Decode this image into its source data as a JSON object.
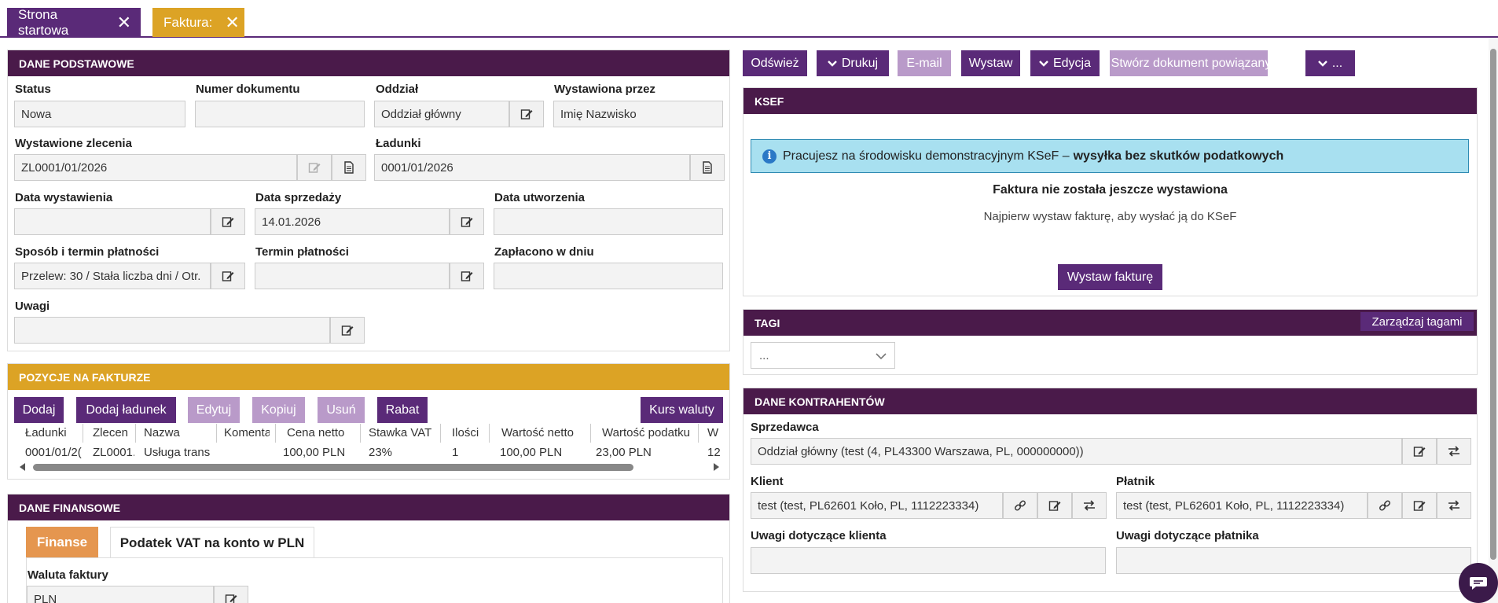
{
  "tabs": [
    {
      "label": "Strona startowa"
    },
    {
      "label": "Faktura:"
    }
  ],
  "basic": {
    "title": "DANE PODSTAWOWE",
    "status_label": "Status",
    "status_value": "Nowa",
    "docnum_label": "Numer dokumentu",
    "docnum_value": "",
    "branch_label": "Oddział",
    "branch_value": "Oddział główny",
    "issued_by_label": "Wystawiona przez",
    "issued_by_value": "Imię Nazwisko",
    "orders_label": "Wystawione zlecenia",
    "orders_value": "ZL0001/01/2026",
    "loads_label": "Ładunki",
    "loads_value": "0001/01/2026",
    "issue_date_label": "Data wystawienia",
    "issue_date_value": "",
    "sale_date_label": "Data sprzedaży",
    "sale_date_value": "14.01.2026",
    "created_label": "Data utworzenia",
    "created_value": "",
    "payment_label": "Sposób i termin płatności",
    "payment_value": "Przelew: 30 / Stała liczba dni / Otr.",
    "due_label": "Termin płatności",
    "due_value": "",
    "paid_label": "Zapłacono w dniu",
    "paid_value": "",
    "notes_label": "Uwagi",
    "notes_value": ""
  },
  "items": {
    "title": "POZYCJE NA FAKTURZE",
    "buttons": {
      "add": "Dodaj",
      "add_load": "Dodaj ładunek",
      "edit": "Edytuj",
      "copy": "Kopiuj",
      "delete": "Usuń",
      "discount": "Rabat",
      "rate": "Kurs waluty"
    },
    "columns": [
      "Ładunki",
      "Zlecen",
      "Nazwa",
      "Komenta",
      "Cena netto",
      "Stawka VAT",
      "Ilości",
      "Wartość netto",
      "Wartość podatku",
      "W"
    ],
    "row": [
      "0001/01/2(",
      "ZL0001.",
      "Usługa trans",
      "",
      "100,00 PLN",
      "23%",
      "1",
      "100,00 PLN",
      "23,00 PLN",
      "12"
    ]
  },
  "finance": {
    "title": "DANE FINANSOWE",
    "tab_finance": "Finanse",
    "tab_vat": "Podatek VAT na konto w PLN",
    "currency_label": "Waluta faktury",
    "currency_value": "PLN"
  },
  "toolbar": {
    "refresh": "Odśwież",
    "print": "Drukuj",
    "email": "E-mail",
    "issue": "Wystaw",
    "edit": "Edycja",
    "related": "Stwórz dokument powiązany",
    "more": "..."
  },
  "ksef": {
    "title": "KSEF",
    "info_text": "Pracujesz na środowisku demonstracyjnym KSeF – ",
    "info_bold": "wysyłka bez skutków podatkowych",
    "heading": "Faktura nie została jeszcze wystawiona",
    "sub": "Najpierw wystaw fakturę, aby wysłać ją do KSeF",
    "button": "Wystaw fakturę"
  },
  "tags": {
    "title": "TAGI",
    "manage": "Zarządzaj tagami",
    "select_value": "..."
  },
  "contractors": {
    "title": "DANE KONTRAHENTÓW",
    "seller_label": "Sprzedawca",
    "seller_value": "Oddział główny (test (4, PL43300 Warszawa, PL, 000000000))",
    "client_label": "Klient",
    "client_value": "test (test, PL62601 Koło, PL, 1112223334)",
    "payer_label": "Płatnik",
    "payer_value": "test (test, PL62601 Koło, PL, 1112223334)",
    "client_notes_label": "Uwagi dotyczące klienta",
    "payer_notes_label": "Uwagi dotyczące płatnika"
  },
  "colors": {
    "purple": "#5a2a78",
    "dark_header": "#4a1a4a",
    "gold": "#dca325",
    "light_purple": "#b99ac9",
    "info_bg": "#a8e0f0"
  }
}
